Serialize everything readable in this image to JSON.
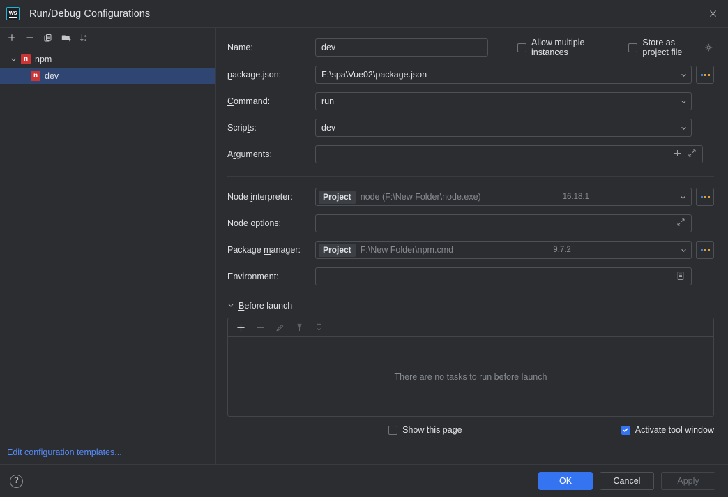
{
  "window": {
    "title": "Run/Debug Configurations",
    "app_icon": "webstorm-logo",
    "close_icon": "close-icon"
  },
  "sidebar": {
    "toolbar": [
      {
        "name": "add-configuration-button",
        "icon": "plus-icon"
      },
      {
        "name": "remove-configuration-button",
        "icon": "minus-icon"
      },
      {
        "name": "copy-configuration-button",
        "icon": "copy-icon"
      },
      {
        "name": "new-folder-button",
        "icon": "folder-add-icon"
      },
      {
        "name": "sort-configurations-button",
        "icon": "sort-alphabetically-icon"
      }
    ],
    "tree": [
      {
        "label": "npm",
        "icon": "npm-icon",
        "type": "group",
        "expanded": true,
        "selected": false
      },
      {
        "label": "dev",
        "icon": "npm-icon",
        "type": "item",
        "expanded": false,
        "selected": true
      }
    ],
    "edit_templates_link": "Edit configuration templates..."
  },
  "form": {
    "name": {
      "label": "Name:",
      "mnemonic": "N",
      "value": "dev"
    },
    "allow_multiple_instances": {
      "label": "Allow multiple instances",
      "checked": false
    },
    "store_as_project_file": {
      "label": "Store as project file",
      "checked": false,
      "gear_icon": "gear-icon"
    },
    "package_json": {
      "label": "package.json:",
      "value": "F:\\spa\\Vue02\\package.json",
      "browse_icon": "ellipsis-icon"
    },
    "command": {
      "label": "Command:",
      "value": "run"
    },
    "scripts": {
      "label": "Scripts:",
      "value": "dev"
    },
    "arguments": {
      "label": "Arguments:",
      "value": "",
      "add_icon": "plus-icon",
      "expand_icon": "expand-icon"
    },
    "node_interpreter": {
      "label": "Node interpreter:",
      "tag": "Project",
      "value": "node (F:\\New Folder\\node.exe)",
      "version": "16.18.1",
      "browse_icon": "ellipsis-icon"
    },
    "node_options": {
      "label": "Node options:",
      "value": "",
      "expand_icon": "expand-icon"
    },
    "package_manager": {
      "label": "Package manager:",
      "tag": "Project",
      "value": "F:\\New Folder\\npm.cmd",
      "version": "9.7.2",
      "browse_icon": "ellipsis-icon"
    },
    "environment": {
      "label": "Environment:",
      "value": "",
      "edit_icon": "environment-variables-icon"
    }
  },
  "before_launch": {
    "title": "Before launch",
    "expanded": true,
    "toolbar": [
      {
        "name": "add-task-button",
        "icon": "plus-icon",
        "enabled": true
      },
      {
        "name": "remove-task-button",
        "icon": "minus-icon",
        "enabled": false
      },
      {
        "name": "edit-task-button",
        "icon": "pencil-icon",
        "enabled": false
      },
      {
        "name": "move-task-up-button",
        "icon": "arrow-up-icon",
        "enabled": false
      },
      {
        "name": "move-task-down-button",
        "icon": "arrow-down-icon",
        "enabled": false
      }
    ],
    "empty_text": "There are no tasks to run before launch",
    "show_this_page": {
      "label": "Show this page",
      "checked": false
    },
    "activate_tool_window": {
      "label": "Activate tool window",
      "checked": true
    }
  },
  "footer": {
    "help_icon": "help-icon",
    "ok": "OK",
    "cancel": "Cancel",
    "apply": "Apply",
    "apply_enabled": false
  },
  "colors": {
    "background": "#2b2d30",
    "accent": "#3574f0",
    "selection": "#2f4673",
    "link": "#548af7",
    "npm_red": "#cc3534",
    "logo_cyan": "#22b4d8",
    "border": "#4d5157",
    "muted_text": "#868a91"
  }
}
